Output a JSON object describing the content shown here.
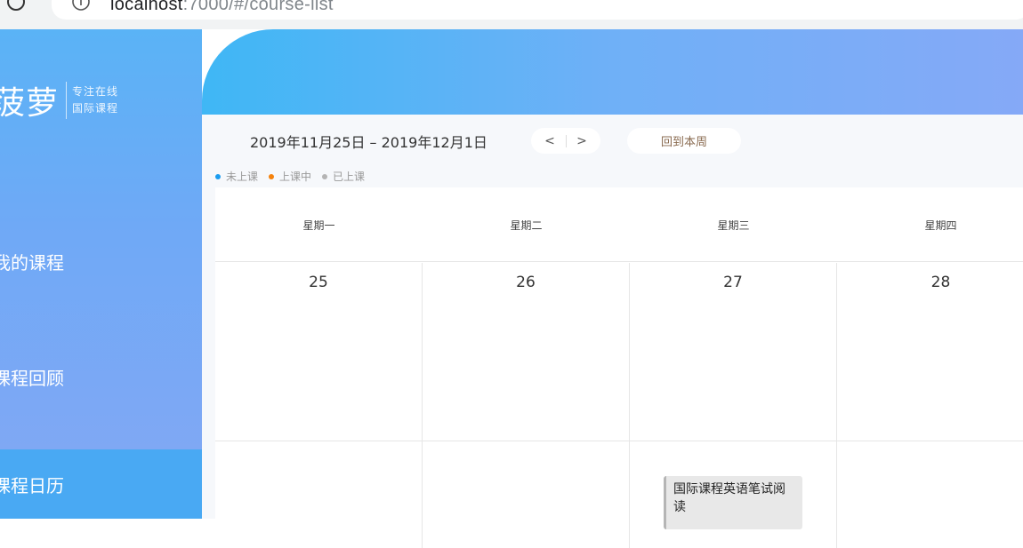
{
  "browser": {
    "url_host": "localhost",
    "url_path": ":7000/#/course-list"
  },
  "sidebar": {
    "brand_name": "菠萝",
    "brand_tag_line1": "专注在线",
    "brand_tag_line2": "国际课程",
    "items": [
      {
        "label": "我的课程"
      },
      {
        "label": "课程回顾"
      },
      {
        "label": "课程日历"
      }
    ]
  },
  "toolbar": {
    "date_range": "2019年11月25日 – 2019年12月1日",
    "prev_label": "<",
    "next_label": ">",
    "today_label": "回到本周"
  },
  "legend": [
    {
      "label": "未上课",
      "color": "#1a9cf0"
    },
    {
      "label": "上课中",
      "color": "#f5820c"
    },
    {
      "label": "已上课",
      "color": "#b4b4b4"
    }
  ],
  "calendar": {
    "weekdays": [
      "星期一",
      "星期二",
      "星期三",
      "星期四"
    ],
    "days": [
      "25",
      "26",
      "27",
      "28"
    ],
    "event": {
      "title": "国际课程英语笔试阅读"
    }
  }
}
